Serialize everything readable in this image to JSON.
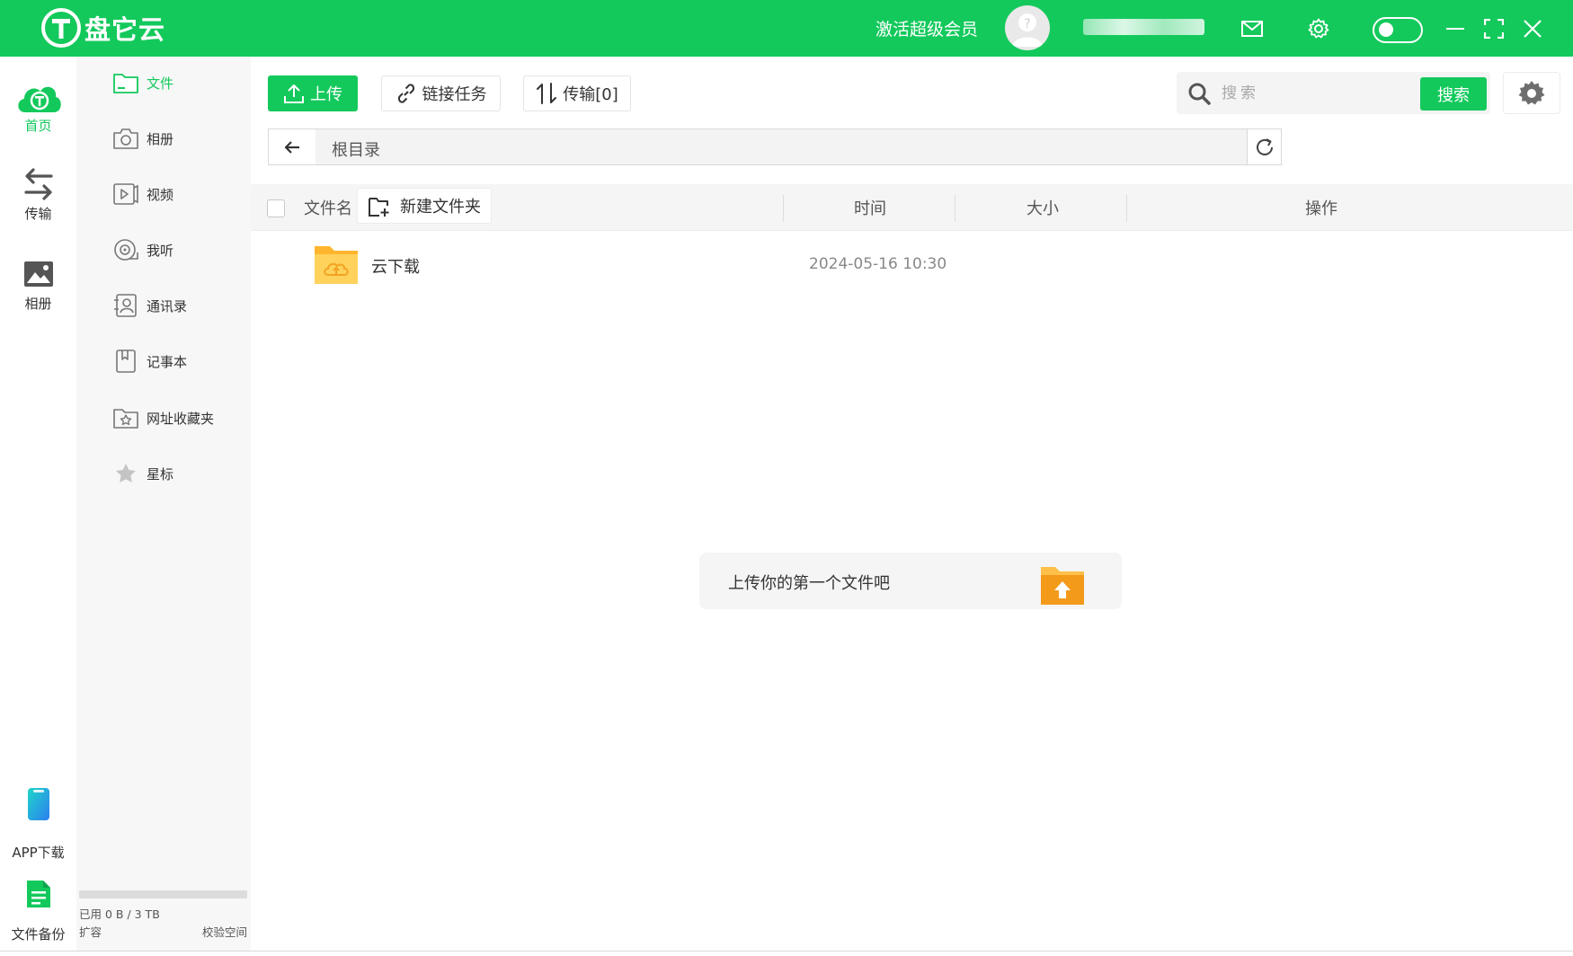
{
  "app": {
    "name": "盘它云",
    "vip_label": "激活超级会员"
  },
  "rail": {
    "items": [
      {
        "label": "首页",
        "icon": "cloud-home-icon"
      },
      {
        "label": "传输",
        "icon": "transfer-arrows-icon"
      },
      {
        "label": "相册",
        "icon": "picture-icon"
      },
      {
        "label": "APP下载",
        "icon": "phone-icon"
      },
      {
        "label": "文件备份",
        "icon": "document-icon"
      }
    ]
  },
  "sidebar": {
    "items": [
      {
        "label": "文件",
        "icon": "folder-icon"
      },
      {
        "label": "相册",
        "icon": "camera-icon"
      },
      {
        "label": "视频",
        "icon": "video-icon"
      },
      {
        "label": "我听",
        "icon": "audio-icon"
      },
      {
        "label": "通讯录",
        "icon": "contact-icon"
      },
      {
        "label": "记事本",
        "icon": "notebook-icon"
      },
      {
        "label": "网址收藏夹",
        "icon": "bookmark-folder-icon"
      },
      {
        "label": "星标",
        "icon": "star-icon"
      }
    ],
    "storage_used": "已用 0 B / 3 TB",
    "storage_fraction": 0,
    "expand_label": "扩容",
    "verify_label": "校验空间"
  },
  "toolbar": {
    "upload_label": "上传",
    "link_task_label": "链接任务",
    "transfer_label": "传输[0]",
    "search_placeholder": "搜索",
    "search_button": "搜索"
  },
  "path": {
    "current": "根目录"
  },
  "table": {
    "headers": {
      "name": "文件名",
      "new_folder": "新建文件夹",
      "time": "时间",
      "size": "大小",
      "action": "操作"
    },
    "rows": [
      {
        "name": "云下载",
        "time": "2024-05-16 10:30",
        "size": "",
        "icon": "cloud-folder-icon"
      }
    ]
  },
  "empty_tip": {
    "text": "上传你的第一个文件吧"
  },
  "colors": {
    "brand": "#14c95c",
    "folder": "#ffc94a",
    "upload_accent": "#f39a1a"
  }
}
